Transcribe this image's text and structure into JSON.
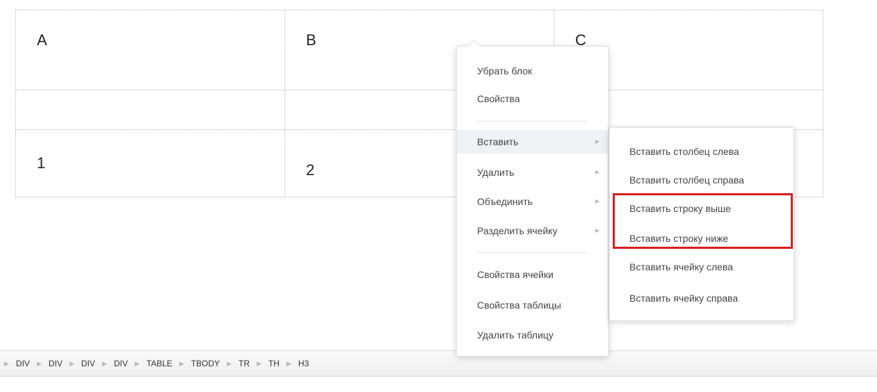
{
  "table": {
    "rows": [
      [
        "A",
        "B",
        "C"
      ],
      [
        "",
        "",
        ""
      ],
      [
        "1",
        "2",
        ""
      ]
    ]
  },
  "context_menu": {
    "remove_block": "Убрать блок",
    "properties": "Свойства",
    "insert": "Вставить",
    "delete": "Удалить",
    "merge": "Объединить",
    "split_cell": "Разделить ячейку",
    "cell_properties": "Свойства ячейки",
    "table_properties": "Свойства таблицы",
    "delete_table": "Удалить таблицу"
  },
  "insert_submenu": {
    "col_left": "Вставить столбец слева",
    "col_right": "Вставить столбец справа",
    "row_above": "Вставить строку выше",
    "row_below": "Вставить строку ниже",
    "cell_left": "Вставить ячейку слева",
    "cell_right": "Вставить ячейку справа"
  },
  "path": [
    "DIV",
    "DIV",
    "DIV",
    "DIV",
    "TABLE",
    "TBODY",
    "TR",
    "TH",
    "H3"
  ],
  "colors": {
    "highlight": "#d61f1f",
    "active_bg": "#eef2f4"
  }
}
